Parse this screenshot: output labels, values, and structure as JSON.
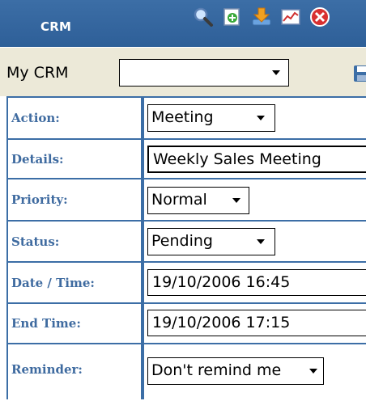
{
  "header": {
    "title": "CRM",
    "icons": [
      "search-icon",
      "add-icon",
      "download-icon",
      "chart-icon",
      "close-icon"
    ]
  },
  "mycrm": {
    "label": "My CRM",
    "selected": ""
  },
  "form": {
    "action": {
      "label": "Action:",
      "value": "Meeting"
    },
    "details": {
      "label": "Details:",
      "value": "Weekly Sales Meeting"
    },
    "priority": {
      "label": "Priority:",
      "value": "Normal"
    },
    "status": {
      "label": "Status:",
      "value": "Pending"
    },
    "datetime": {
      "label": "Date / Time:",
      "value": "19/10/2006 16:45"
    },
    "endtime": {
      "label": "End Time:",
      "value": "19/10/2006 17:15"
    },
    "reminder": {
      "label": "Reminder:",
      "value": "Don't remind me"
    }
  },
  "colors": {
    "header_blue": "#3c6ea6",
    "label_text": "#3f6ba0",
    "toolbar_bg": "#ece9d8"
  }
}
